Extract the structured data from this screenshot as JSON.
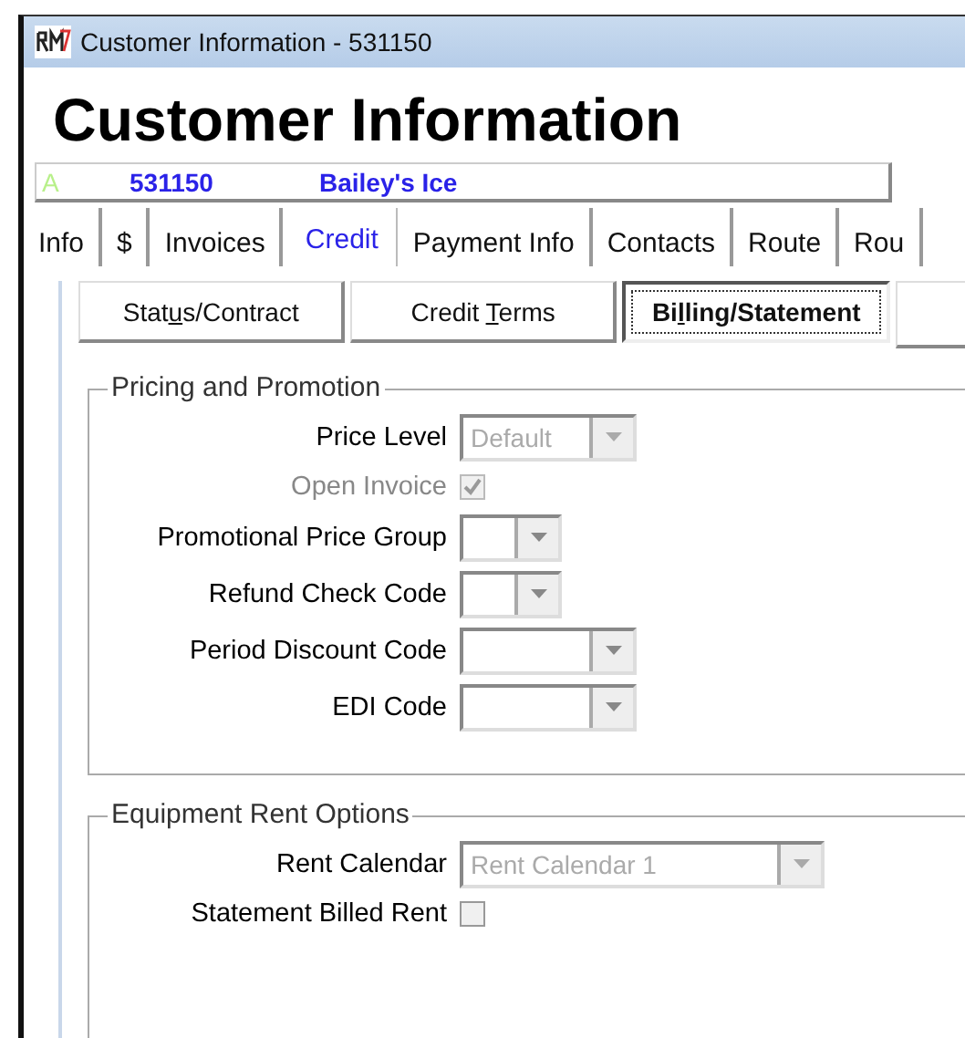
{
  "window": {
    "title": "Customer Information - 531150"
  },
  "heading": "Customer Information",
  "customer": {
    "status": "A",
    "number": "531150",
    "name": "Bailey's Ice"
  },
  "tabs": [
    {
      "label": "Info",
      "selected": false
    },
    {
      "label": "$",
      "selected": false
    },
    {
      "label": "Invoices",
      "selected": false
    },
    {
      "label": "Credit",
      "selected": true
    },
    {
      "label": "Payment Info",
      "selected": false
    },
    {
      "label": "Contacts",
      "selected": false
    },
    {
      "label": "Route",
      "selected": false
    },
    {
      "label": "Rou",
      "selected": false
    }
  ],
  "subtabs": [
    {
      "label_before": "Stat",
      "access_key": "u",
      "label_after": "s/Contract",
      "selected": false
    },
    {
      "label_before": "Credit ",
      "access_key": "T",
      "label_after": "erms",
      "selected": false
    },
    {
      "label_before": "Bi",
      "access_key": "l",
      "label_after": "ling/Statement",
      "selected": true
    }
  ],
  "groups": [
    {
      "title": "Pricing and Promotion",
      "fields": [
        {
          "kind": "combo",
          "label": "Price Level",
          "value": "Default",
          "disabled": true
        },
        {
          "kind": "check",
          "label": "Open Invoice",
          "checked": true,
          "disabled": true
        },
        {
          "kind": "combo",
          "label": "Promotional Price Group",
          "disabled": false
        },
        {
          "kind": "combo",
          "label": "Refund Check Code",
          "disabled": false
        },
        {
          "kind": "combo",
          "label": "Period Discount Code",
          "disabled": false
        },
        {
          "kind": "combo",
          "label": "EDI Code",
          "disabled": false
        }
      ]
    },
    {
      "title": "Equipment Rent Options",
      "fields": [
        {
          "kind": "combo",
          "label": "Rent Calendar",
          "value": "Rent Calendar 1",
          "disabled": true
        },
        {
          "kind": "check",
          "label": "Statement Billed Rent",
          "checked": false,
          "disabled": false
        }
      ]
    }
  ]
}
